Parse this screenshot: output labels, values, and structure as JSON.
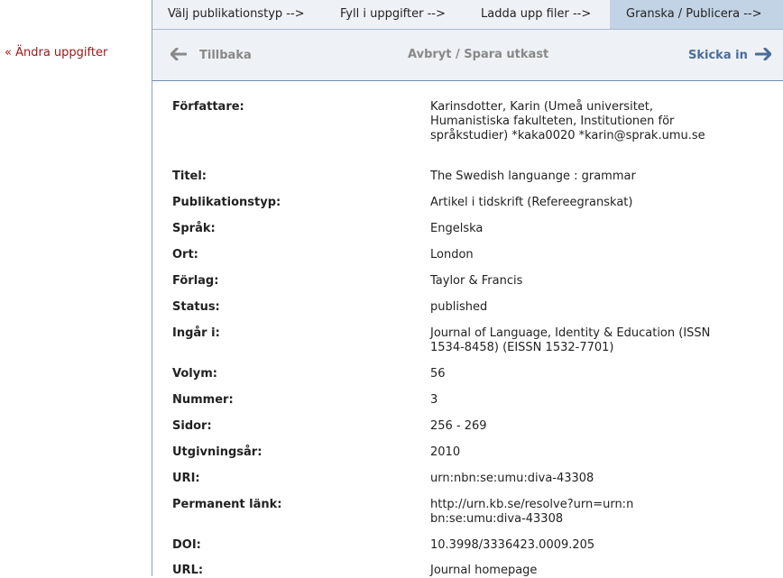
{
  "left": {
    "change_link": "« Ändra uppgifter"
  },
  "steps": [
    {
      "label": "Välj publikationstyp -->"
    },
    {
      "label": "Fyll i uppgifter -->"
    },
    {
      "label": "Ladda upp filer -->"
    },
    {
      "label": "Granska / Publicera -->",
      "active": true
    }
  ],
  "actions": {
    "back": "Tillbaka",
    "cancel": "Avbryt / Spara utkast",
    "submit": "Skicka in"
  },
  "fields": [
    {
      "label": "Författare:",
      "value": "Karinsdotter, Karin (Umeå universitet, Humanistiska fakulteten, Institutionen för språkstudier) *kaka0020 *karin@sprak.umu.se"
    },
    {
      "label": "Titel:",
      "value": "The Swedish languange : grammar"
    },
    {
      "label": "Publikationstyp:",
      "value": "Artikel i tidskrift (Refereegranskat)"
    },
    {
      "label": "Språk:",
      "value": "Engelska"
    },
    {
      "label": "Ort:",
      "value": "London"
    },
    {
      "label": "Förlag:",
      "value": "Taylor & Francis"
    },
    {
      "label": "Status:",
      "value": "published"
    },
    {
      "label": "Ingår i:",
      "value": "Journal of Language, Identity & Education (ISSN 1534-8458) (EISSN 1532-7701)"
    },
    {
      "label": "Volym:",
      "value": "56"
    },
    {
      "label": "Nummer:",
      "value": "3"
    },
    {
      "label": "Sidor:",
      "value": "256 - 269"
    },
    {
      "label": "Utgivningsår:",
      "value": "2010"
    },
    {
      "label": "URI:",
      "value": "urn:nbn:se:umu:diva-43308"
    },
    {
      "label": "Permanent länk:",
      "value": "http://urn.kb.se/resolve?urn=urn:nbn:se:umu:diva-43308"
    },
    {
      "label": "DOI:",
      "value": "10.3998/3336423.0009.205"
    },
    {
      "label": "URL:",
      "value": "Journal homepage"
    }
  ]
}
